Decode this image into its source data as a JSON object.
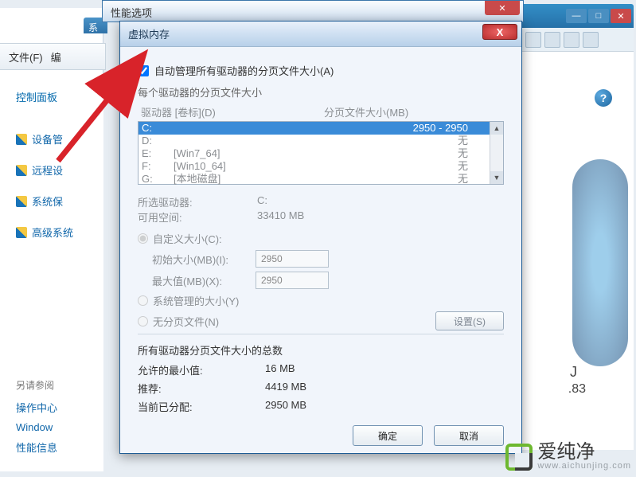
{
  "perf_options_title": "性能选项",
  "system_title": "系",
  "menu": {
    "file": "文件(F)",
    "edit": "编"
  },
  "sidebar": {
    "control_panel": "控制面板",
    "items": [
      {
        "label": "设备管"
      },
      {
        "label": "远程设"
      },
      {
        "label": "系统保"
      },
      {
        "label": "高级系统"
      }
    ],
    "see_also": "另请参阅",
    "bottom": [
      {
        "label": "操作中心"
      },
      {
        "label": "Window"
      },
      {
        "label": "性能信息"
      }
    ]
  },
  "vm": {
    "title": "虚拟内存",
    "auto_manage": "自动管理所有驱动器的分页文件大小(A)",
    "per_drive_title": "每个驱动器的分页文件大小",
    "list_header_drive": "驱动器 [卷标](D)",
    "list_header_size": "分页文件大小(MB)",
    "drives": [
      {
        "letter": "C:",
        "label": "",
        "size": "2950 - 2950"
      },
      {
        "letter": "D:",
        "label": "",
        "size": "无"
      },
      {
        "letter": "E:",
        "label": "[Win7_64]",
        "size": "无"
      },
      {
        "letter": "F:",
        "label": "[Win10_64]",
        "size": "无"
      },
      {
        "letter": "G:",
        "label": "[本地磁盘]",
        "size": "无"
      }
    ],
    "selected_drive_label": "所选驱动器:",
    "selected_drive_value": "C:",
    "free_space_label": "可用空间:",
    "free_space_value": "33410 MB",
    "custom_size": "自定义大小(C):",
    "initial_label": "初始大小(MB)(I):",
    "initial_value": "2950",
    "max_label": "最大值(MB)(X):",
    "max_value": "2950",
    "system_managed": "系统管理的大小(Y)",
    "no_paging": "无分页文件(N)",
    "set_button": "设置(S)",
    "totals_title": "所有驱动器分页文件大小的总数",
    "min_allowed_label": "允许的最小值:",
    "min_allowed_value": "16 MB",
    "recommended_label": "推荐:",
    "recommended_value": "4419 MB",
    "current_label": "当前已分配:",
    "current_value": "2950 MB",
    "ok": "确定",
    "cancel": "取消"
  },
  "bg_right": {
    "j": "J",
    "n83": ".83"
  },
  "watermark": {
    "text": "爱纯净",
    "sub": "www.aichunjing.com"
  }
}
